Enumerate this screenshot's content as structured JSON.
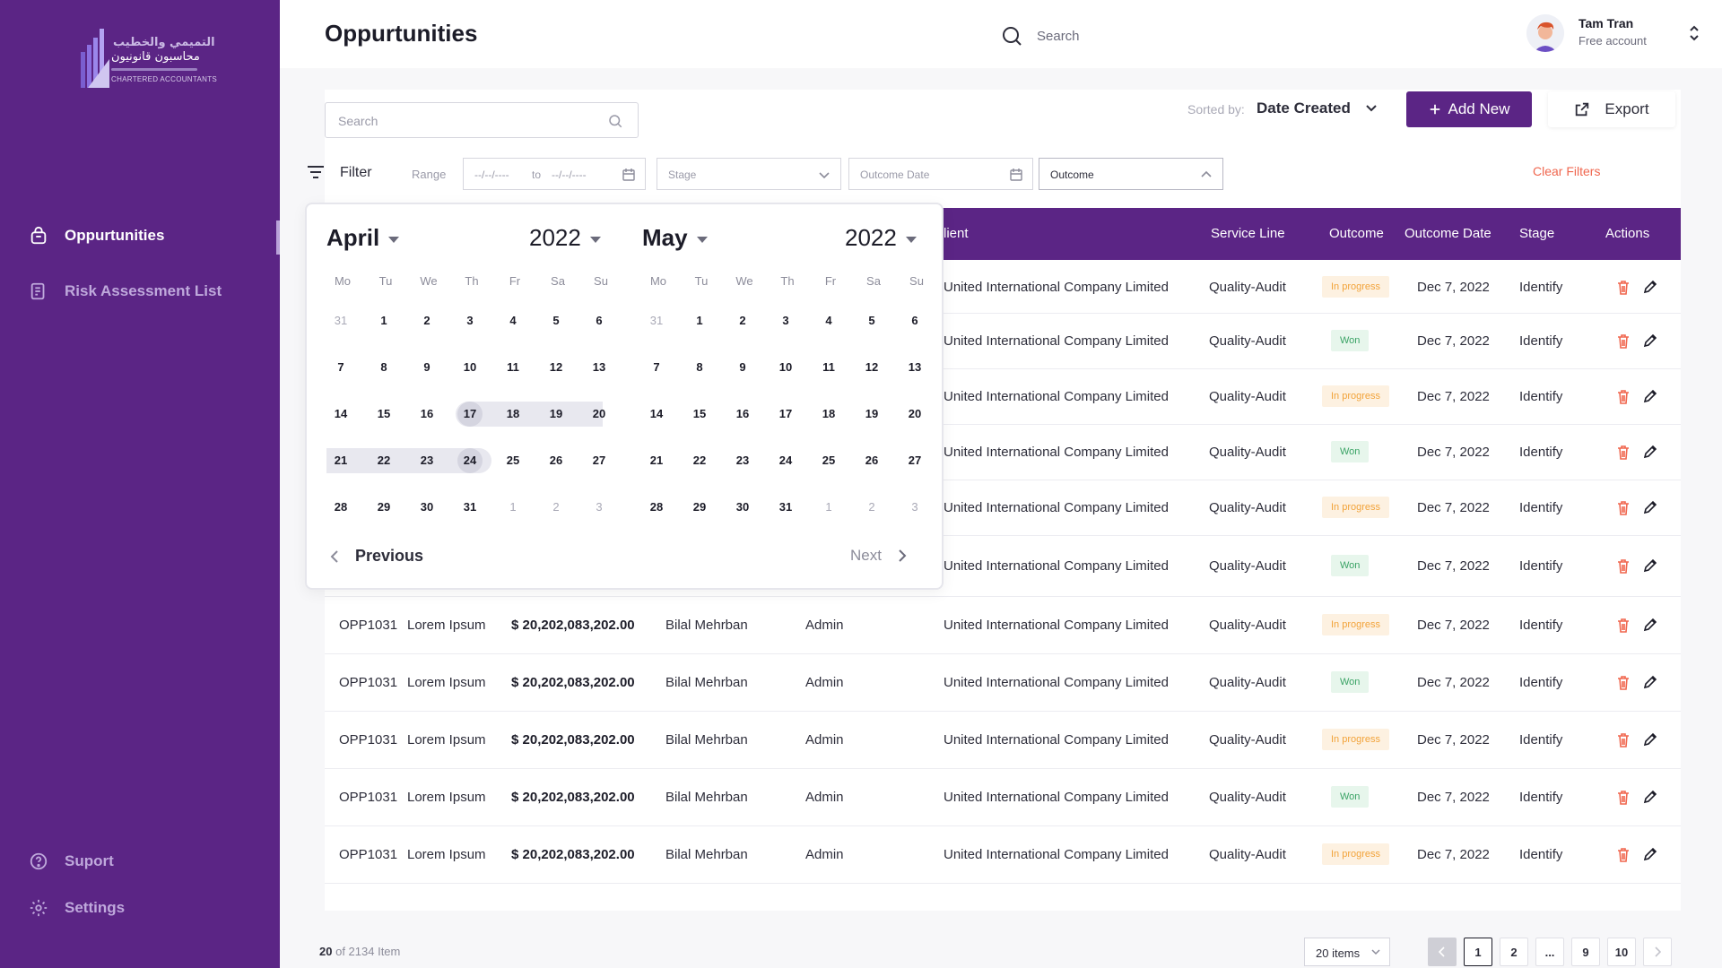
{
  "sidebar": {
    "logo_text_ar": "التميمي والخطيب",
    "logo_text_ar2": "محاسبون قانونيون",
    "logo_text_en": "CHARTERED ACCOUNTANTS",
    "items": [
      {
        "label": "Oppurtunities",
        "icon": "bag-icon",
        "active": true
      },
      {
        "label": "Risk Assessment List",
        "icon": "document-list-icon",
        "active": false
      }
    ],
    "bottom": [
      {
        "label": "Suport",
        "icon": "help-circle-icon"
      },
      {
        "label": "Settings",
        "icon": "gear-icon"
      }
    ],
    "color": "#5b2585"
  },
  "header": {
    "title": "Oppurtunities",
    "search_placeholder": "Search",
    "user_name": "Tam Tran",
    "user_plan": "Free account"
  },
  "toolbar": {
    "search_placeholder": "Search",
    "sort_label": "Sorted by:",
    "sort_value": "Date Created",
    "add_label": "Add New",
    "export_label": "Export"
  },
  "filters": {
    "label": "Filter",
    "range_label": "Range",
    "range_from": "--/--/----",
    "range_to_label": "to",
    "range_to": "--/--/----",
    "stage": "Stage",
    "outcome_date": "Outcome Date",
    "outcome": "Outcome",
    "clear": "Clear Filters"
  },
  "table": {
    "columns": [
      "lient",
      "Service Line",
      "Outcome",
      "Outcome Date",
      "Stage",
      "Actions"
    ],
    "rows": [
      {
        "id": "",
        "name": "",
        "amount": "",
        "owner": "",
        "role": "",
        "client": "United International Company Limited",
        "service": "Quality-Audit",
        "outcome": "In progress",
        "date": "Dec 7, 2022",
        "stage": "Identify"
      },
      {
        "id": "",
        "name": "",
        "amount": "",
        "owner": "",
        "role": "",
        "client": "United International Company Limited",
        "service": "Quality-Audit",
        "outcome": "Won",
        "date": "Dec 7, 2022",
        "stage": "Identify"
      },
      {
        "id": "",
        "name": "",
        "amount": "",
        "owner": "",
        "role": "",
        "client": "United International Company Limited",
        "service": "Quality-Audit",
        "outcome": "In progress",
        "date": "Dec 7, 2022",
        "stage": "Identify"
      },
      {
        "id": "",
        "name": "",
        "amount": "",
        "owner": "",
        "role": "",
        "client": "United International Company Limited",
        "service": "Quality-Audit",
        "outcome": "Won",
        "date": "Dec 7, 2022",
        "stage": "Identify"
      },
      {
        "id": "",
        "name": "",
        "amount": "",
        "owner": "",
        "role": "",
        "client": "United International Company Limited",
        "service": "Quality-Audit",
        "outcome": "In progress",
        "date": "Dec 7, 2022",
        "stage": "Identify"
      },
      {
        "id": "",
        "name": "",
        "amount": "",
        "owner": "",
        "role": "",
        "client": "United International Company Limited",
        "service": "Quality-Audit",
        "outcome": "Won",
        "date": "Dec 7, 2022",
        "stage": "Identify"
      },
      {
        "id": "OPP1031",
        "name": "Lorem Ipsum",
        "amount": "$ 20,202,083,202.00",
        "owner": "Bilal Mehrban",
        "role": "Admin",
        "client": "United International Company Limited",
        "service": "Quality-Audit",
        "outcome": "In progress",
        "date": "Dec 7, 2022",
        "stage": "Identify"
      },
      {
        "id": "OPP1031",
        "name": "Lorem Ipsum",
        "amount": "$ 20,202,083,202.00",
        "owner": "Bilal Mehrban",
        "role": "Admin",
        "client": "United International Company Limited",
        "service": "Quality-Audit",
        "outcome": "Won",
        "date": "Dec 7, 2022",
        "stage": "Identify"
      },
      {
        "id": "OPP1031",
        "name": "Lorem Ipsum",
        "amount": "$ 20,202,083,202.00",
        "owner": "Bilal Mehrban",
        "role": "Admin",
        "client": "United International Company Limited",
        "service": "Quality-Audit",
        "outcome": "In progress",
        "date": "Dec 7, 2022",
        "stage": "Identify"
      },
      {
        "id": "OPP1031",
        "name": "Lorem Ipsum",
        "amount": "$ 20,202,083,202.00",
        "owner": "Bilal Mehrban",
        "role": "Admin",
        "client": "United International Company Limited",
        "service": "Quality-Audit",
        "outcome": "Won",
        "date": "Dec 7, 2022",
        "stage": "Identify"
      },
      {
        "id": "OPP1031",
        "name": "Lorem Ipsum",
        "amount": "$ 20,202,083,202.00",
        "owner": "Bilal Mehrban",
        "role": "Admin",
        "client": "United International Company Limited",
        "service": "Quality-Audit",
        "outcome": "In progress",
        "date": "Dec 7, 2022",
        "stage": "Identify"
      }
    ]
  },
  "calendar": {
    "weekdays": [
      "Mo",
      "Tu",
      "We",
      "Th",
      "Fr",
      "Sa",
      "Su"
    ],
    "months": [
      {
        "month": "April",
        "year": "2022",
        "days": [
          [
            "31",
            "1",
            "2",
            "3",
            "4",
            "5",
            "6"
          ],
          [
            "7",
            "8",
            "9",
            "10",
            "11",
            "12",
            "13"
          ],
          [
            "14",
            "15",
            "16",
            "17",
            "18",
            "19",
            "20"
          ],
          [
            "21",
            "22",
            "23",
            "24",
            "25",
            "26",
            "27"
          ],
          [
            "28",
            "29",
            "30",
            "31",
            "1",
            "2",
            "3"
          ]
        ]
      },
      {
        "month": "May",
        "year": "2022",
        "days": [
          [
            "31",
            "1",
            "2",
            "3",
            "4",
            "5",
            "6"
          ],
          [
            "7",
            "8",
            "9",
            "10",
            "11",
            "12",
            "13"
          ],
          [
            "14",
            "15",
            "16",
            "17",
            "18",
            "19",
            "20"
          ],
          [
            "21",
            "22",
            "23",
            "24",
            "25",
            "26",
            "27"
          ],
          [
            "28",
            "29",
            "30",
            "31",
            "1",
            "2",
            "3"
          ]
        ]
      }
    ],
    "selected_range": {
      "start": "17",
      "end": "24"
    },
    "prev_label": "Previous",
    "next_label": "Next"
  },
  "pagination": {
    "count": "20",
    "count_rest": "of 2134 Item",
    "per_page": "20 items",
    "pages": [
      "1",
      "2",
      "...",
      "9",
      "10"
    ],
    "current": "1"
  },
  "colors": {
    "accent": "#5b2585",
    "progress": "#f2a33a",
    "won": "#3aa365",
    "delete": "#f0674f"
  }
}
